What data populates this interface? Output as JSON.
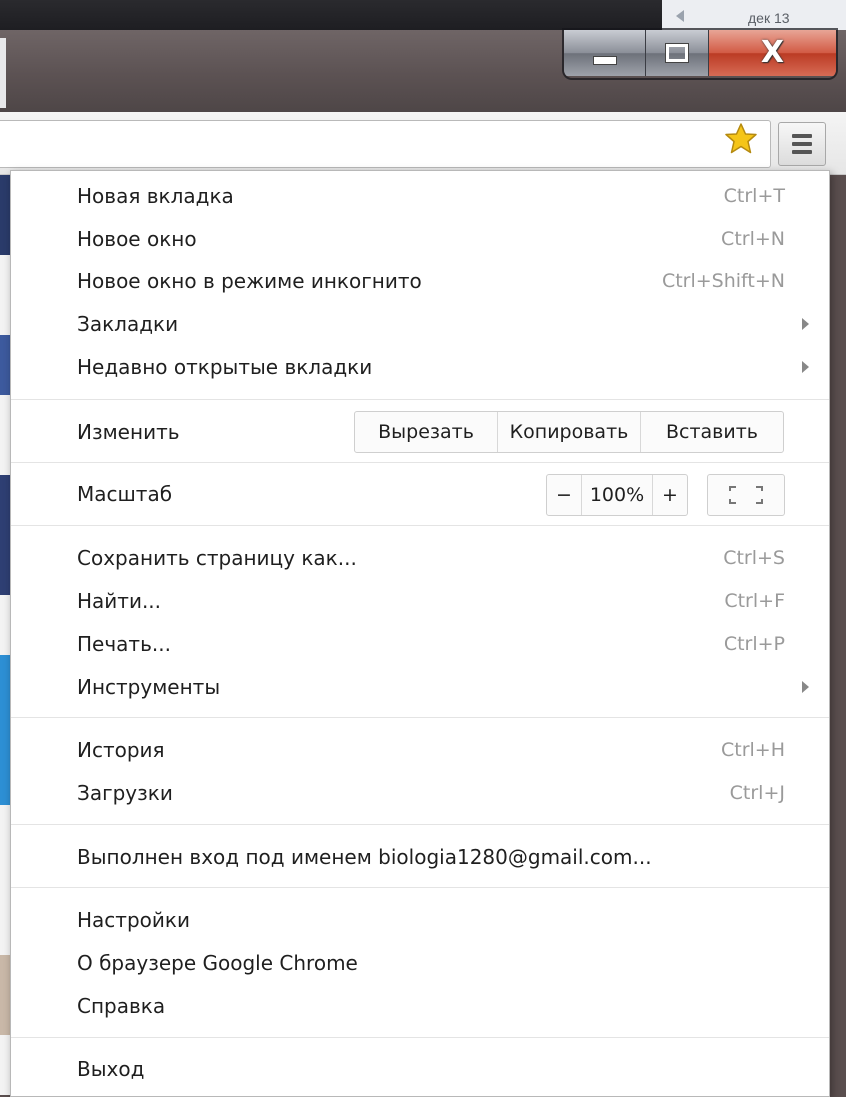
{
  "background": {
    "date_label": "дек 13"
  },
  "window_controls": {
    "minimize": "minimize-icon",
    "maximize": "maximize-icon",
    "close_glyph": "X"
  },
  "toolbar": {
    "bookmark_star": "star-icon",
    "menu_button": "hamburger-icon"
  },
  "menu": {
    "group1": [
      {
        "label": "Новая вкладка",
        "shortcut": "Ctrl+T"
      },
      {
        "label": "Новое окно",
        "shortcut": "Ctrl+N"
      },
      {
        "label": "Новое окно в режиме инкогнито",
        "shortcut": "Ctrl+Shift+N"
      },
      {
        "label": "Закладки",
        "submenu": true
      },
      {
        "label": "Недавно открытые вкладки",
        "submenu": true
      }
    ],
    "edit": {
      "label": "Изменить",
      "cut": "Вырезать",
      "copy": "Копировать",
      "paste": "Вставить"
    },
    "zoom": {
      "label": "Масштаб",
      "minus": "−",
      "value": "100%",
      "plus": "+"
    },
    "group2": [
      {
        "label": "Сохранить страницу как...",
        "shortcut": "Ctrl+S"
      },
      {
        "label": "Найти...",
        "shortcut": "Ctrl+F"
      },
      {
        "label": "Печать...",
        "shortcut": "Ctrl+P"
      },
      {
        "label": "Инструменты",
        "submenu": true
      }
    ],
    "group3": [
      {
        "label": "История",
        "shortcut": "Ctrl+H"
      },
      {
        "label": "Загрузки",
        "shortcut": "Ctrl+J"
      }
    ],
    "signed_in": "Выполнен вход под именем biologia1280@gmail.com...",
    "group4": [
      {
        "label": "Настройки"
      },
      {
        "label": "О браузере Google Chrome"
      },
      {
        "label": "Справка"
      }
    ],
    "exit": "Выход"
  },
  "colors": {
    "close_red": "#c94a33",
    "star_yellow": "#f5c518",
    "shortcut_gray": "#9a9a9a"
  }
}
